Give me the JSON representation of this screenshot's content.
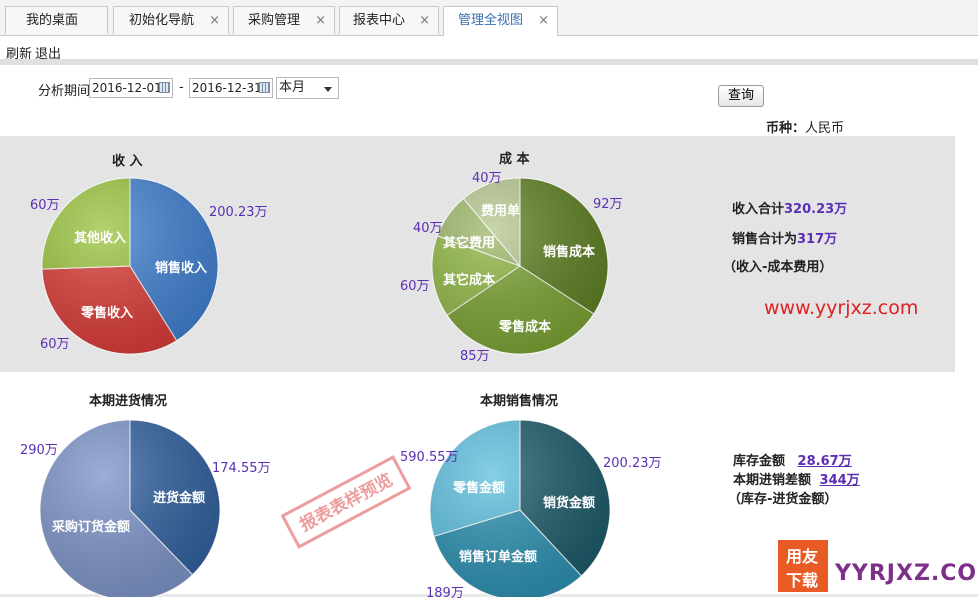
{
  "tabs": [
    {
      "label": "我的桌面",
      "close": ""
    },
    {
      "label": "初始化导航",
      "close": "×"
    },
    {
      "label": "采购管理",
      "close": "×"
    },
    {
      "label": "报表中心",
      "close": "×"
    },
    {
      "label": "管理全视图",
      "close": "×"
    }
  ],
  "toolbar": {
    "refresh": "刷新",
    "exit": "退出"
  },
  "filter": {
    "label": "分析期间",
    "start_date": "2016-12-01",
    "separator": "-",
    "end_date": "2016-12-31",
    "period": "本月",
    "query_button": "查询"
  },
  "currency": {
    "label": "币种：",
    "value": "人民币"
  },
  "income_chart": {
    "title": "收  入",
    "slices": [
      {
        "name": "销售收入",
        "value_label": "200.23万"
      },
      {
        "name": "零售收入",
        "value_label": "60万"
      },
      {
        "name": "其他收入",
        "value_label": "60万"
      }
    ]
  },
  "cost_chart": {
    "title": "成  本",
    "slices": [
      {
        "name": "销售成本",
        "value_label": "92万"
      },
      {
        "name": "零售成本",
        "value_label": "85万"
      },
      {
        "name": "其它成本",
        "value_label": "60万"
      },
      {
        "name": "其它费用",
        "value_label": "40万"
      },
      {
        "name": "费用单",
        "value_label": "40万"
      }
    ]
  },
  "summary_top": {
    "income_total_label": "收入合计",
    "income_total_value": "320.23万",
    "sales_total_label": "销售合计为",
    "sales_total_value": "317万",
    "formula": "（收入-成本费用）"
  },
  "purchase_chart": {
    "title": "本期进货情况",
    "slices": [
      {
        "name": "进货金额",
        "value_label": "174.55万"
      },
      {
        "name": "采购订货金额",
        "value_label": "290万"
      }
    ]
  },
  "sales_chart": {
    "title": "本期销售情况",
    "slices": [
      {
        "name": "销货金额",
        "value_label": "200.23万"
      },
      {
        "name": "销售订单金额",
        "value_label": "189万"
      },
      {
        "name": "零售金额",
        "value_label": "590.55万"
      }
    ]
  },
  "summary_bottom": {
    "inventory_label": "库存金额",
    "inventory_value": "28.67万",
    "diff_label": "本期进销差额",
    "diff_value": "344万",
    "formula": "（库存-进货金额）"
  },
  "watermark_url": "www.yyrjxz.com",
  "stamp_text": "报表表样预览",
  "logo": {
    "line1": "用友",
    "line2": "下载",
    "text": "YYRJXZ.COM"
  },
  "colors": {
    "income": [
      "#3f7fd0",
      "#d93a36",
      "#9bc43f"
    ],
    "cost": [
      "#5d7f21",
      "#7aa232",
      "#8fb743",
      "#9fb86a",
      "#b6c790"
    ],
    "purchase": [
      "#2f5f9e",
      "#7b93c7"
    ],
    "sales": [
      "#1a5868",
      "#2a8fb0",
      "#5cbfde"
    ],
    "value_text": "#5b2fb5"
  }
}
